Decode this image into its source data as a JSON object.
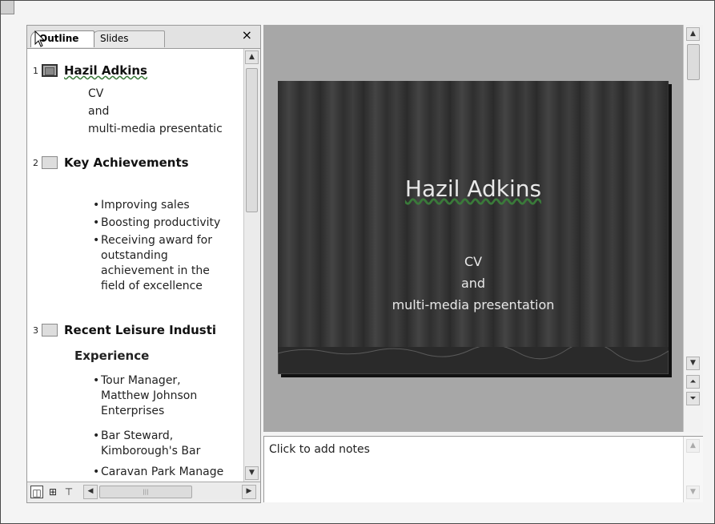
{
  "panel": {
    "tabs": [
      {
        "label": "Outline",
        "active": true
      },
      {
        "label": "Slides",
        "active": false
      }
    ],
    "close_glyph": "×"
  },
  "outline": {
    "slides": [
      {
        "number": "1",
        "title": "Hazil Adkins",
        "lines": [
          "CV",
          "and",
          "multi-media presentatic"
        ]
      },
      {
        "number": "2",
        "title": "Key Achievements",
        "bullets": [
          "Improving sales",
          "Boosting productivity",
          "Receiving award for outstanding achievement in the field of excellence"
        ]
      },
      {
        "number": "3",
        "title": "Recent Leisure Industi",
        "title_line2": "Experience",
        "bullets": [
          "Tour Manager, Matthew Johnson Enterprises",
          "Bar Steward, Kimborough's Bar",
          "Caravan Park Manage"
        ]
      }
    ]
  },
  "view_buttons": [
    {
      "name": "normal-view",
      "icon": "normal-view-icon"
    },
    {
      "name": "slide-sorter",
      "icon": "slide-sorter-icon"
    },
    {
      "name": "slide-show",
      "icon": "slide-show-icon"
    }
  ],
  "slide": {
    "title": "Hazil Adkins",
    "subtitle_lines": [
      "CV",
      "and",
      "multi-media presentation"
    ]
  },
  "notes": {
    "placeholder": "Click to add notes"
  },
  "colors": {
    "slide_background": "#3f3f3f",
    "workspace": "#a7a7a7",
    "spell_check_underline": "#3a7a3a"
  }
}
